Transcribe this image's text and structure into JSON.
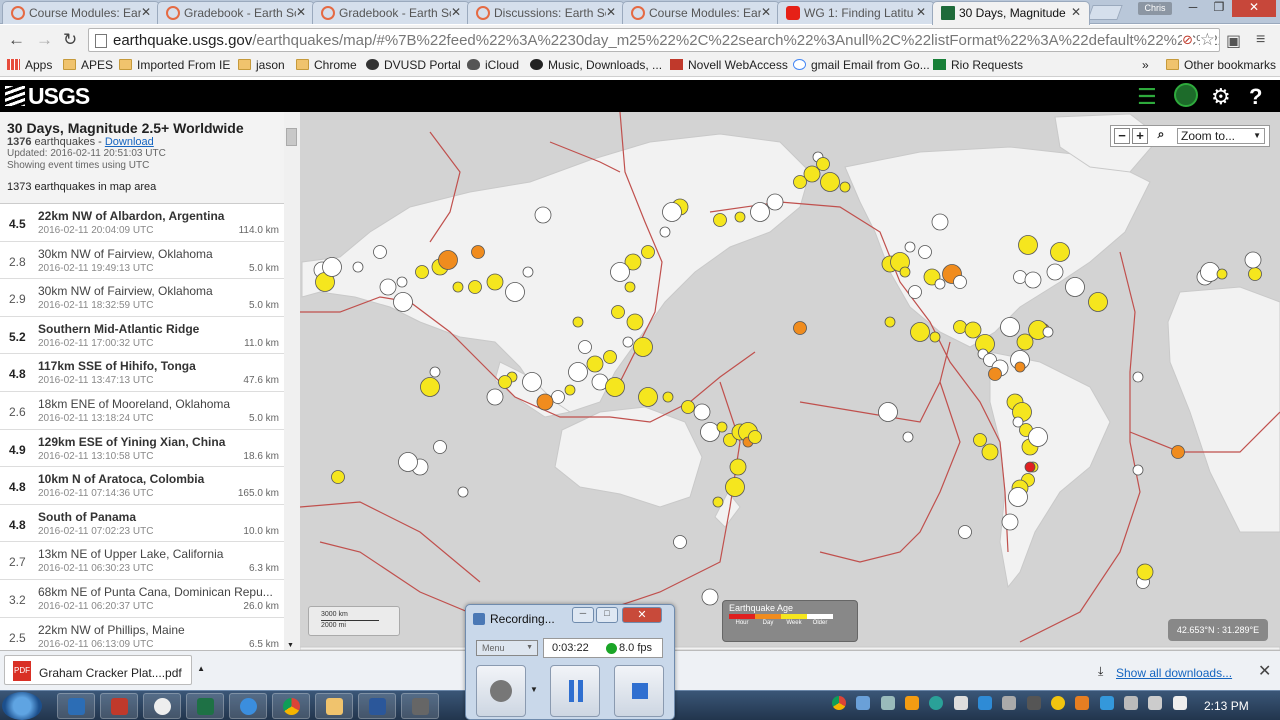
{
  "browser": {
    "tabs": [
      {
        "label": "Course Modules: Earth",
        "favicon": "canvas-icon",
        "active": false
      },
      {
        "label": "Gradebook - Earth Sc",
        "favicon": "canvas-icon",
        "active": false
      },
      {
        "label": "Gradebook - Earth Sc",
        "favicon": "canvas-icon",
        "active": false
      },
      {
        "label": "Discussions: Earth Sc",
        "favicon": "canvas-icon",
        "active": false
      },
      {
        "label": "Course Modules: Earth",
        "favicon": "canvas-icon",
        "active": false
      },
      {
        "label": "WG 1: Finding Latitu",
        "favicon": "youtube-icon",
        "active": false
      },
      {
        "label": "30 Days, Magnitude",
        "favicon": "usgs-icon",
        "active": true
      }
    ],
    "user": "Chris",
    "url_host": "earthquake.usgs.gov",
    "url_path": "/earthquakes/map/#%7B%22feed%22%3A%2230day_m25%22%2C%22search%22%3Anull%2C%22listFormat%22%3A%22default%22%2C%22...",
    "bookmarks": [
      {
        "label": "Apps",
        "icon": "apps-icon"
      },
      {
        "label": "APES",
        "icon": "folder-icon"
      },
      {
        "label": "Imported From IE",
        "icon": "folder-icon"
      },
      {
        "label": "jason",
        "icon": "folder-icon"
      },
      {
        "label": "Chrome",
        "icon": "folder-icon"
      },
      {
        "label": "DVUSD Portal",
        "icon": "dvusd-icon"
      },
      {
        "label": "iCloud",
        "icon": "apple-icon"
      },
      {
        "label": "Music, Downloads, ...",
        "icon": "music-icon"
      },
      {
        "label": "Novell WebAccess",
        "icon": "mail-icon"
      },
      {
        "label": "gmail Email from Go...",
        "icon": "google-icon"
      },
      {
        "label": "Rio Requests",
        "icon": "sheets-icon"
      }
    ],
    "bookmarks_overflow": "»",
    "other_bookmarks": "Other bookmarks"
  },
  "usgs": {
    "logo": "USGS",
    "list_title": "30 Days, Magnitude 2.5+ Worldwide",
    "count_line": "1376",
    "count_suffix": " earthquakes - ",
    "download_link": "Download",
    "updated": "Updated: 2016-02-11 20:51:03 UTC",
    "time_note": "Showing event times using UTC",
    "in_area": "1373 earthquakes in map area",
    "earthquakes": [
      {
        "mag": "4.5",
        "place": "22km NW of Albardon, Argentina",
        "time": "2016-02-11 20:04:09 UTC",
        "depth": "114.0 km"
      },
      {
        "mag": "2.8",
        "place": "30km NW of Fairview, Oklahoma",
        "time": "2016-02-11 19:49:13 UTC",
        "depth": "5.0 km"
      },
      {
        "mag": "2.9",
        "place": "30km NW of Fairview, Oklahoma",
        "time": "2016-02-11 18:32:59 UTC",
        "depth": "5.0 km"
      },
      {
        "mag": "5.2",
        "place": "Southern Mid-Atlantic Ridge",
        "time": "2016-02-11 17:00:32 UTC",
        "depth": "11.0 km"
      },
      {
        "mag": "4.8",
        "place": "117km SSE of Hihifo, Tonga",
        "time": "2016-02-11 13:47:13 UTC",
        "depth": "47.6 km"
      },
      {
        "mag": "2.6",
        "place": "18km ENE of Mooreland, Oklahoma",
        "time": "2016-02-11 13:18:24 UTC",
        "depth": "5.0 km"
      },
      {
        "mag": "4.9",
        "place": "129km ESE of Yining Xian, China",
        "time": "2016-02-11 13:10:58 UTC",
        "depth": "18.6 km"
      },
      {
        "mag": "4.8",
        "place": "10km N of Aratoca, Colombia",
        "time": "2016-02-11 07:14:36 UTC",
        "depth": "165.0 km"
      },
      {
        "mag": "4.8",
        "place": "South of Panama",
        "time": "2016-02-11 07:02:23 UTC",
        "depth": "10.0 km"
      },
      {
        "mag": "2.7",
        "place": "13km NE of Upper Lake, California",
        "time": "2016-02-11 06:30:23 UTC",
        "depth": "6.3 km"
      },
      {
        "mag": "3.2",
        "place": "68km NE of Punta Cana, Dominican Repu...",
        "time": "2016-02-11 06:20:37 UTC",
        "depth": "26.0 km"
      },
      {
        "mag": "2.5",
        "place": "22km NW of Phillips, Maine",
        "time": "2016-02-11 06:13:09 UTC",
        "depth": "6.5 km"
      }
    ],
    "zoom_label": "Zoom to...",
    "scale_top": "3000 km",
    "scale_bottom": "2000 mi",
    "legend_title": "Earthquake Age",
    "legend_items": [
      {
        "label": "Hour",
        "color": "#e02020"
      },
      {
        "label": "Day",
        "color": "#f08c1e"
      },
      {
        "label": "Week",
        "color": "#f5e61e"
      },
      {
        "label": "Older",
        "color": "#ffffff"
      }
    ],
    "coords": "42.653°N : 31.289°E"
  },
  "downloads": {
    "file": "Graham Cracker Plat....pdf",
    "show_all": "Show all downloads..."
  },
  "recorder": {
    "title": "Recording...",
    "menu": "Menu",
    "elapsed": "0:03:22",
    "fps": "8.0 fps"
  },
  "taskbar": {
    "clock": "2:13 PM"
  },
  "colors": {
    "usgs_bar": "#000000",
    "map_bg": "#d3d3d3",
    "land": "#f2f2f2",
    "plate_boundary": "#c0504d",
    "quake_older": "#ffffff",
    "quake_week": "#f5e61e",
    "quake_day": "#f08c1e",
    "quake_hour": "#e02020"
  }
}
